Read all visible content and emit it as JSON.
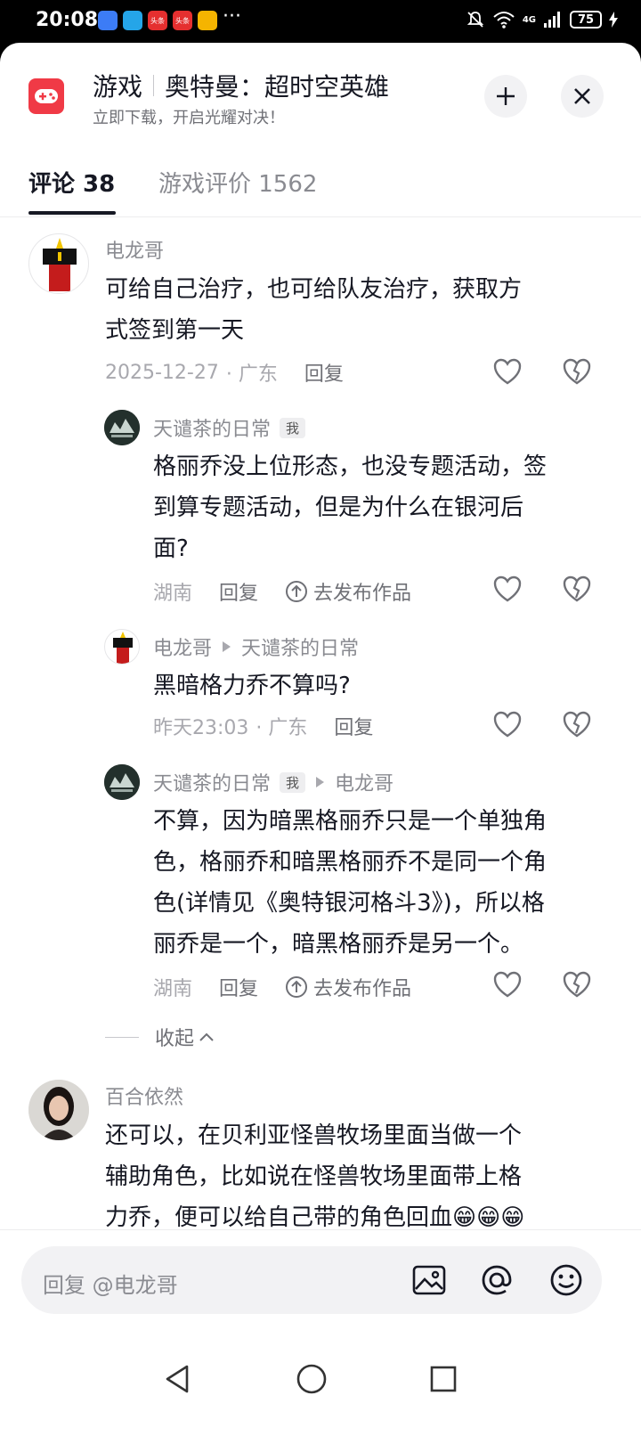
{
  "status_bar": {
    "time": "20:08",
    "battery": "75",
    "app_icon_text": "头条",
    "network": "4G",
    "dots": "···"
  },
  "header": {
    "category": "游戏",
    "title": "奥特曼：超时空英雄",
    "subtitle": "立即下载，开启光耀对决！"
  },
  "tabs": [
    {
      "label": "评论 38",
      "active": true
    },
    {
      "label": "游戏评价 1562",
      "active": false
    }
  ],
  "comments": {
    "c1": {
      "author": "电龙哥",
      "text_lines": [
        "可给自己治疗，也可给队友治疗，获取方",
        "式签到第一天"
      ],
      "date": "2025-12-27",
      "location": "· 广东",
      "reply_label": "回复"
    },
    "r1": {
      "author": "天谴茶的日常",
      "badge": "我",
      "text_lines": [
        "格丽乔没上位形态，也没专题活动，签",
        "到算专题活动，但是为什么在银河后",
        "面?"
      ],
      "location": "湖南",
      "reply_label": "回复",
      "publish_label": "去发布作品"
    },
    "r2": {
      "author": "电龙哥",
      "reply_to": "天谴茶的日常",
      "text_lines": [
        "黑暗格力乔不算吗?"
      ],
      "date": "昨天23:03",
      "location": "· 广东",
      "reply_label": "回复"
    },
    "r3": {
      "author": "天谴茶的日常",
      "badge": "我",
      "reply_to": "电龙哥",
      "text_lines": [
        "不算，因为暗黑格丽乔只是一个单独角",
        "色，格丽乔和暗黑格丽乔不是同一个角",
        "色(详情见《奥特银河格斗3》)，所以格",
        "丽乔是一个，暗黑格丽乔是另一个。"
      ],
      "location": "湖南",
      "reply_label": "回复",
      "publish_label": "去发布作品"
    },
    "collapse_label": "收起",
    "c2": {
      "author": "百合依然",
      "text_lines": [
        "还可以，在贝利亚怪兽牧场里面当做一个",
        "辅助角色，比如说在怪兽牧场里面带上格",
        "力乔，便可以给自己带的角色回血😁😁😁"
      ]
    }
  },
  "input": {
    "placeholder": "回复 @电龙哥"
  },
  "colors": {
    "accent": "#f03a46",
    "text": "#161823",
    "muted": "#8a8b91"
  }
}
